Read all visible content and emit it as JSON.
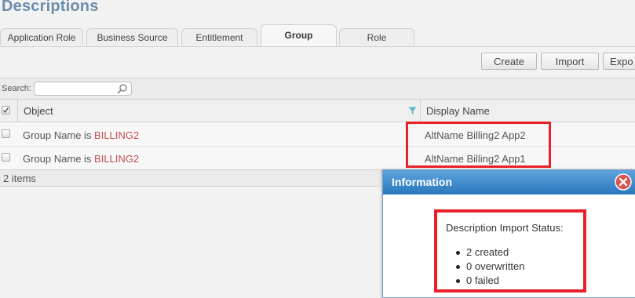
{
  "page": {
    "title": "Descriptions"
  },
  "tabs": [
    {
      "label": "Application Role",
      "active": false
    },
    {
      "label": "Business Source",
      "active": false
    },
    {
      "label": "Entitlement",
      "active": false
    },
    {
      "label": "Group",
      "active": true
    },
    {
      "label": "Role",
      "active": false
    }
  ],
  "toolbar": {
    "create_label": "Create",
    "import_label": "Import",
    "export_label": "Expo"
  },
  "search": {
    "label": "Search:",
    "value": "",
    "placeholder": ""
  },
  "table": {
    "columns": [
      "Object",
      "Display Name"
    ],
    "rows": [
      {
        "object_prefix": "Group Name is ",
        "object_value": "BILLING2",
        "display_name": "AltName Billing2 App2"
      },
      {
        "object_prefix": "Group Name is ",
        "object_value": "BILLING2",
        "display_name": "AltName Billing2 App1"
      }
    ],
    "footer": "2 items"
  },
  "dialog": {
    "title": "Information",
    "heading": "Description Import Status:",
    "items": [
      "2 created",
      "0 overwritten",
      "0 failed"
    ]
  },
  "colors": {
    "title": "#6b8db0",
    "highlight_border": "#e8202a",
    "dialog_header": "#2a78bd",
    "link_value": "#c0504d"
  }
}
